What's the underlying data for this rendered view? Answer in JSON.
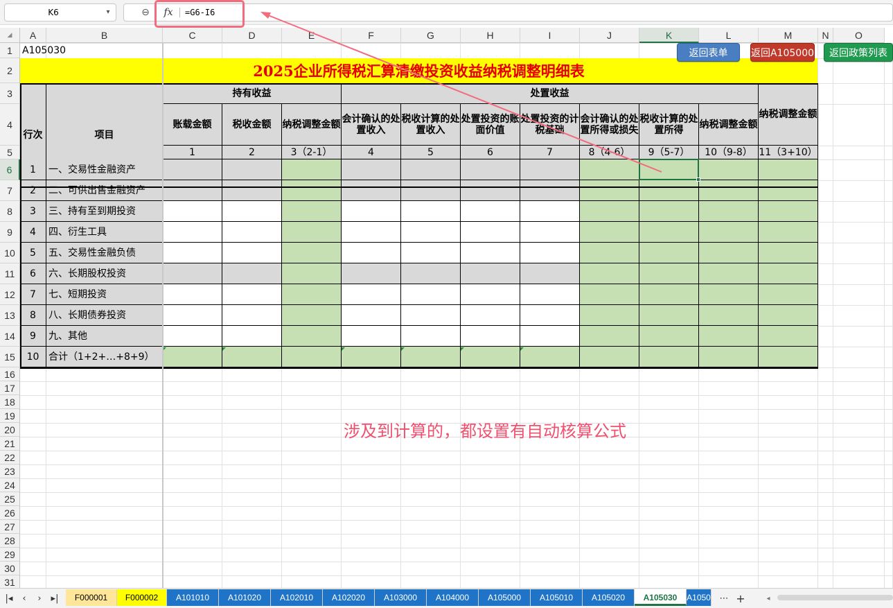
{
  "formula_bar": {
    "name_box": "K6",
    "zoom_icon": "zoom-icon",
    "fx_label": "fx",
    "formula": "=G6-I6"
  },
  "grid": {
    "columns": [
      "A",
      "B",
      "C",
      "D",
      "E",
      "F",
      "G",
      "H",
      "I",
      "J",
      "K",
      "L",
      "M",
      "N",
      "O"
    ],
    "rows": [
      "1",
      "2",
      "3",
      "4",
      "5",
      "6",
      "7",
      "8",
      "9",
      "10",
      "11",
      "12",
      "13",
      "14",
      "15",
      "16",
      "17",
      "18",
      "19",
      "20",
      "21",
      "22",
      "23",
      "24",
      "25",
      "26",
      "27",
      "28",
      "29",
      "30",
      "31"
    ],
    "selected_column": "K",
    "selected_row": "6"
  },
  "sheet": {
    "code": "A105030",
    "title": "2025企业所得税汇算清缴投资收益纳税调整明细表",
    "headers": {
      "row_no": "行次",
      "item": "项目",
      "holding_income": "持有收益",
      "disposal_income": "处置收益",
      "cols": [
        "账载金额",
        "税收金额",
        "纳税调整金额",
        "会计确认的处置收入",
        "税收计算的处置收入",
        "处置投资的账面价值",
        "处置投资的计税基础",
        "会计确认的处置所得或损失",
        "税收计算的处置所得",
        "纳税调整金额",
        "纳税调整金额"
      ],
      "col_numbers": [
        "1",
        "2",
        "3（2-1）",
        "4",
        "5",
        "6",
        "7",
        "8（4-6）",
        "9（5-7）",
        "10（9-8）",
        "11（3+10）"
      ]
    },
    "rows": [
      {
        "no": "1",
        "item": "一、交易性金融资产"
      },
      {
        "no": "2",
        "item": "二、可供出售金融资产"
      },
      {
        "no": "3",
        "item": "三、持有至到期投资"
      },
      {
        "no": "4",
        "item": "四、衍生工具"
      },
      {
        "no": "5",
        "item": "五、交易性金融负债"
      },
      {
        "no": "6",
        "item": "六、长期股权投资"
      },
      {
        "no": "7",
        "item": "七、短期投资"
      },
      {
        "no": "8",
        "item": "八、长期债券投资"
      },
      {
        "no": "9",
        "item": "九、其他"
      },
      {
        "no": "10",
        "item": "合计（1+2+…+8+9）"
      }
    ]
  },
  "buttons": {
    "back_list": "返回表单",
    "back_a105000": "返回A105000",
    "back_policy": "返回政策列表"
  },
  "colors": {
    "title_text": "#e60000",
    "title_bg": "#ffff00",
    "input_green": "#c6e0b4",
    "locked_gray": "#d9d9d9",
    "btn_blue": "#4a7ec2",
    "btn_red": "#c0392b",
    "btn_green": "#1e9b4f",
    "annotation": "#f0506e",
    "tab_blue": "#1f74c8"
  },
  "annotation": "涉及到计算的，都设置有自动核算公式",
  "tabs": {
    "items": [
      "F000001",
      "F000002",
      "A101010",
      "A101020",
      "A102010",
      "A102020",
      "A103000",
      "A104000",
      "A105000",
      "A105010",
      "A105020",
      "A105030",
      "A1050"
    ],
    "active": "A105030",
    "more": "⋯",
    "add": "+"
  }
}
